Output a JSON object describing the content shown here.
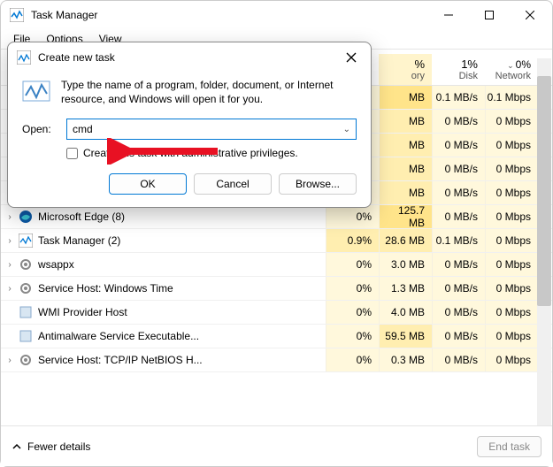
{
  "window": {
    "title": "Task Manager"
  },
  "menu": {
    "file": "File",
    "options": "Options",
    "view": "View"
  },
  "headers": {
    "memory": {
      "pct": "%",
      "label": "ory"
    },
    "disk": {
      "pct": "1%",
      "label": "Disk"
    },
    "network": {
      "pct": "0%",
      "label": "Network"
    }
  },
  "rows": [
    {
      "name": "",
      "cpu": "",
      "mem": "MB",
      "disk": "0.1 MB/s",
      "net": "0.1 Mbps",
      "heat": [
        "h2",
        "h0",
        "h0"
      ]
    },
    {
      "name": "",
      "cpu": "",
      "mem": "MB",
      "disk": "0 MB/s",
      "net": "0 Mbps",
      "heat": [
        "h1",
        "h0",
        "h0"
      ]
    },
    {
      "name": "",
      "cpu": "",
      "mem": "MB",
      "disk": "0 MB/s",
      "net": "0 Mbps",
      "heat": [
        "h1",
        "h0",
        "h0"
      ]
    },
    {
      "name": "",
      "cpu": "",
      "mem": "MB",
      "disk": "0 MB/s",
      "net": "0 Mbps",
      "heat": [
        "h1",
        "h0",
        "h0"
      ]
    },
    {
      "name": "",
      "cpu": "",
      "mem": "MB",
      "disk": "0 MB/s",
      "net": "0 Mbps",
      "heat": [
        "h1",
        "h0",
        "h0"
      ]
    },
    {
      "name": "Microsoft Edge (8)",
      "cpu": "0%",
      "mem": "125.7 MB",
      "disk": "0 MB/s",
      "net": "0 Mbps",
      "heat": [
        "h2",
        "h0",
        "h0"
      ],
      "chev": true,
      "icon": "edge"
    },
    {
      "name": "Task Manager (2)",
      "cpu": "0.9%",
      "mem": "28.6 MB",
      "disk": "0.1 MB/s",
      "net": "0 Mbps",
      "heat": [
        "h1",
        "h0",
        "h0"
      ],
      "chev": true,
      "icon": "tm",
      "cpuheat": "h1"
    },
    {
      "name": "wsappx",
      "cpu": "0%",
      "mem": "3.0 MB",
      "disk": "0 MB/s",
      "net": "0 Mbps",
      "heat": [
        "h0",
        "h0",
        "h0"
      ],
      "chev": true,
      "icon": "gear"
    },
    {
      "name": "Service Host: Windows Time",
      "cpu": "0%",
      "mem": "1.3 MB",
      "disk": "0 MB/s",
      "net": "0 Mbps",
      "heat": [
        "h0",
        "h0",
        "h0"
      ],
      "chev": true,
      "icon": "gear"
    },
    {
      "name": "WMI Provider Host",
      "cpu": "0%",
      "mem": "4.0 MB",
      "disk": "0 MB/s",
      "net": "0 Mbps",
      "heat": [
        "h0",
        "h0",
        "h0"
      ],
      "chev": false,
      "icon": "box"
    },
    {
      "name": "Antimalware Service Executable...",
      "cpu": "0%",
      "mem": "59.5 MB",
      "disk": "0 MB/s",
      "net": "0 Mbps",
      "heat": [
        "h1",
        "h0",
        "h0"
      ],
      "chev": false,
      "icon": "box"
    },
    {
      "name": "Service Host: TCP/IP NetBIOS H...",
      "cpu": "0%",
      "mem": "0.3 MB",
      "disk": "0 MB/s",
      "net": "0 Mbps",
      "heat": [
        "h0",
        "h0",
        "h0"
      ],
      "chev": true,
      "icon": "gear"
    }
  ],
  "footer": {
    "fewer": "Fewer details",
    "endtask": "End task"
  },
  "dialog": {
    "title": "Create new task",
    "desc": "Type the name of a program, folder, document, or Internet resource, and Windows will open it for you.",
    "open_label": "Open:",
    "value": "cmd",
    "admin_label": "Create this task with administrative privileges.",
    "ok": "OK",
    "cancel": "Cancel",
    "browse": "Browse..."
  }
}
